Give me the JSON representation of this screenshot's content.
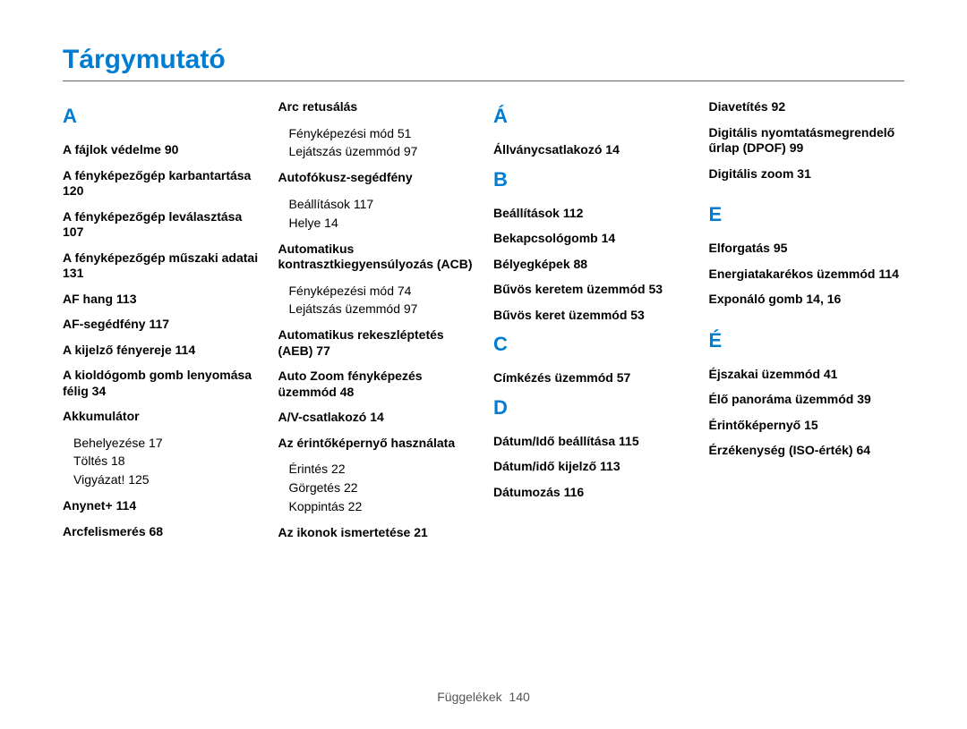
{
  "title": "Tárgymutató",
  "footer": {
    "label": "Függelékek",
    "page": "140"
  },
  "col1": {
    "letter": "A",
    "entries": [
      {
        "text": "A fájlok védelme",
        "page": "90"
      },
      {
        "text": "A fényképezőgép karbantartása",
        "page": "120"
      },
      {
        "text": "A fényképezőgép leválasztása",
        "page": "107"
      },
      {
        "text": "A fényképezőgép műszaki adatai",
        "page": "131"
      },
      {
        "text": "AF hang",
        "page": "113"
      },
      {
        "text": "AF-segédfény",
        "page": "117"
      },
      {
        "text": "A kijelző fényereje",
        "page": "114"
      },
      {
        "text": "A kioldógomb gomb lenyomása félig",
        "page": "34"
      },
      {
        "text": "Akkumulátor",
        "subs": [
          {
            "text": "Behelyezése",
            "page": "17"
          },
          {
            "text": "Töltés",
            "page": "18"
          },
          {
            "text": "Vigyázat!",
            "page": "125"
          }
        ]
      },
      {
        "text": "Anynet+",
        "page": "114"
      },
      {
        "text": "Arcfelismerés",
        "page": "68"
      }
    ]
  },
  "col2": {
    "entries": [
      {
        "text": "Arc retusálás",
        "subs": [
          {
            "text": "Fényképezési mód",
            "page": "51"
          },
          {
            "text": "Lejátszás üzemmód",
            "page": "97"
          }
        ]
      },
      {
        "text": "Autofókusz-segédfény",
        "subs": [
          {
            "text": "Beállítások",
            "page": "117"
          },
          {
            "text": "Helye",
            "page": "14"
          }
        ]
      },
      {
        "text": "Automatikus kontrasztkiegyensúlyozás (ACB)",
        "subs": [
          {
            "text": "Fényképezési mód",
            "page": "74"
          },
          {
            "text": "Lejátszás üzemmód",
            "page": "97"
          }
        ]
      },
      {
        "text": "Automatikus rekeszléptetés (AEB)",
        "page": "77"
      },
      {
        "text": "Auto Zoom fényképezés üzemmód",
        "page": "48"
      },
      {
        "text": "A/V-csatlakozó",
        "page": "14"
      },
      {
        "text": "Az érintőképernyő használata",
        "subs": [
          {
            "text": "Érintés",
            "page": "22"
          },
          {
            "text": "Görgetés",
            "page": "22"
          },
          {
            "text": "Koppintás",
            "page": "22"
          }
        ]
      },
      {
        "text": "Az ikonok ismertetése",
        "page": "21"
      }
    ]
  },
  "col3": {
    "sections": [
      {
        "letter": "Á",
        "entries": [
          {
            "text": "Állványcsatlakozó",
            "page": "14"
          }
        ]
      },
      {
        "letter": "B",
        "entries": [
          {
            "text": "Beállítások",
            "page": "112"
          },
          {
            "text": "Bekapcsológomb",
            "page": "14"
          },
          {
            "text": "Bélyegképek",
            "page": "88"
          },
          {
            "text": "Bűvös keretem üzemmód",
            "page": "53"
          },
          {
            "text": "Bűvös keret üzemmód",
            "page": "53"
          }
        ]
      },
      {
        "letter": "C",
        "entries": [
          {
            "text": "Címkézés üzemmód",
            "page": "57"
          }
        ]
      },
      {
        "letter": "D",
        "entries": [
          {
            "text": "Dátum/Idő beállítása",
            "page": "115"
          },
          {
            "text": "Dátum/idő kijelző",
            "page": "113"
          },
          {
            "text": "Dátumozás",
            "page": "116"
          }
        ]
      }
    ]
  },
  "col4": {
    "top": [
      {
        "text": "Diavetítés",
        "page": "92"
      },
      {
        "text": "Digitális nyomtatásmegrendelő űrlap (DPOF)",
        "page": "99"
      },
      {
        "text": "Digitális zoom",
        "page": "31"
      }
    ],
    "sections": [
      {
        "letter": "E",
        "entries": [
          {
            "text": "Elforgatás",
            "page": "95"
          },
          {
            "text": "Energiatakarékos üzemmód",
            "page": "114"
          },
          {
            "text": "Exponáló gomb",
            "page": "14, 16"
          }
        ]
      },
      {
        "letter": "É",
        "entries": [
          {
            "text": "Éjszakai üzemmód",
            "page": "41"
          },
          {
            "text": "Élő panoráma üzemmód",
            "page": "39"
          },
          {
            "text": "Érintőképernyő",
            "page": "15"
          },
          {
            "text": "Érzékenység (ISO-érték)",
            "page": "64"
          }
        ]
      }
    ]
  }
}
